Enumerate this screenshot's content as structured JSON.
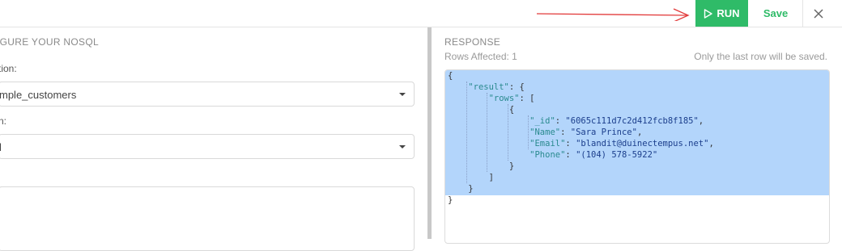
{
  "toolbar": {
    "run_label": "RUN",
    "save_label": "Save",
    "run_color": "#2fbb68"
  },
  "left_panel": {
    "section_title": "IGURE YOUR NOSQL",
    "collection": {
      "label": "tion:",
      "value": "mple_customers"
    },
    "operation": {
      "label": "n:",
      "value": "l"
    }
  },
  "response": {
    "title": "RESPONSE",
    "rows_affected": "Rows Affected: 1",
    "note": "Only the last row will be saved.",
    "json_lines": [
      [
        {
          "t": "{",
          "c": "p"
        }
      ],
      [
        {
          "t": "    ",
          "c": "p"
        },
        {
          "t": "\"result\"",
          "c": "k"
        },
        {
          "t": ": {",
          "c": "p"
        }
      ],
      [
        {
          "t": "        ",
          "c": "p"
        },
        {
          "t": "\"rows\"",
          "c": "k"
        },
        {
          "t": ": [",
          "c": "p"
        }
      ],
      [
        {
          "t": "            {",
          "c": "p"
        }
      ],
      [
        {
          "t": "                ",
          "c": "p"
        },
        {
          "t": "\"_id\"",
          "c": "k"
        },
        {
          "t": ": ",
          "c": "p"
        },
        {
          "t": "\"6065c111d7c2d412fcb8f185\"",
          "c": "s"
        },
        {
          "t": ",",
          "c": "p"
        }
      ],
      [
        {
          "t": "                ",
          "c": "p"
        },
        {
          "t": "\"Name\"",
          "c": "k"
        },
        {
          "t": ": ",
          "c": "p"
        },
        {
          "t": "\"Sara Prince\"",
          "c": "s"
        },
        {
          "t": ",",
          "c": "p"
        }
      ],
      [
        {
          "t": "                ",
          "c": "p"
        },
        {
          "t": "\"Email\"",
          "c": "k"
        },
        {
          "t": ": ",
          "c": "p"
        },
        {
          "t": "\"blandit@duinectempus.net\"",
          "c": "s"
        },
        {
          "t": ",",
          "c": "p"
        }
      ],
      [
        {
          "t": "                ",
          "c": "p"
        },
        {
          "t": "\"Phone\"",
          "c": "k"
        },
        {
          "t": ": ",
          "c": "p"
        },
        {
          "t": "\"(104) 578-5922\"",
          "c": "s"
        }
      ],
      [
        {
          "t": "            }",
          "c": "p"
        }
      ],
      [
        {
          "t": "        ]",
          "c": "p"
        }
      ],
      [
        {
          "t": "    }",
          "c": "p"
        }
      ],
      [
        {
          "t": "}",
          "c": "p"
        }
      ]
    ]
  }
}
